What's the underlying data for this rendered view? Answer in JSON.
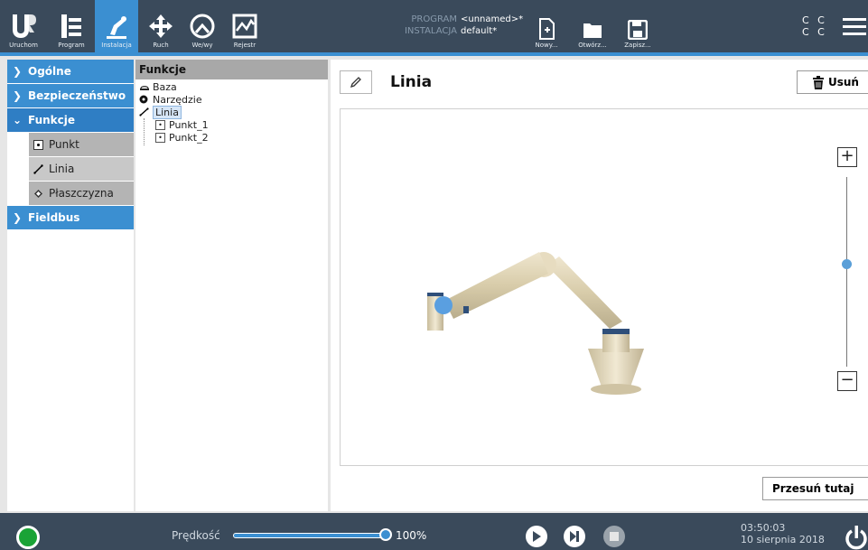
{
  "header": {
    "tabs": [
      {
        "label": "Uruchom",
        "icon": "ur-logo-icon"
      },
      {
        "label": "Program",
        "icon": "program-tree-icon"
      },
      {
        "label": "Instalacja",
        "icon": "installation-robot-icon"
      },
      {
        "label": "Ruch",
        "icon": "move-arrows-icon"
      },
      {
        "label": "We/wy",
        "icon": "io-gauge-icon"
      },
      {
        "label": "Rejestr",
        "icon": "log-chart-icon"
      }
    ],
    "active_tab": "Instalacja",
    "program_key": "PROGRAM",
    "program_value": "<unnamed>*",
    "installation_key": "INSTALACJA",
    "installation_value": "default*",
    "file_buttons": {
      "new": "Nowy...",
      "open": "Otwórz...",
      "save": "Zapisz..."
    },
    "cc_line1": "C C",
    "cc_line2": "C C"
  },
  "nav": {
    "items": [
      {
        "label": "Ogólne"
      },
      {
        "label": "Bezpieczeństwo"
      },
      {
        "label": "Funkcje"
      },
      {
        "label": "Fieldbus"
      }
    ],
    "sub_items": [
      {
        "label": "Punkt",
        "icon": "point-icon"
      },
      {
        "label": "Linia",
        "icon": "line-icon"
      },
      {
        "label": "Płaszczyzna",
        "icon": "plane-icon"
      }
    ],
    "active_sub": "Linia"
  },
  "tree": {
    "header": "Funkcje",
    "items": {
      "base": "Baza",
      "tool": "Narzędzie",
      "line": "Linia",
      "point1": "Punkt_1",
      "point2": "Punkt_2"
    }
  },
  "main": {
    "title": "Linia",
    "delete_label": "Usuń",
    "zoom_in": "+",
    "zoom_out": "−",
    "move_label": "Przesuń tutaj"
  },
  "footer": {
    "speed_label": "Prędkość",
    "speed_value": "100%",
    "speed_fraction": 1.0,
    "time": "03:50:03",
    "date": "10 sierpnia 2018"
  },
  "colors": {
    "header_bg": "#3a4a5b",
    "accent": "#3b8fd1",
    "status_green": "#1aa336"
  }
}
